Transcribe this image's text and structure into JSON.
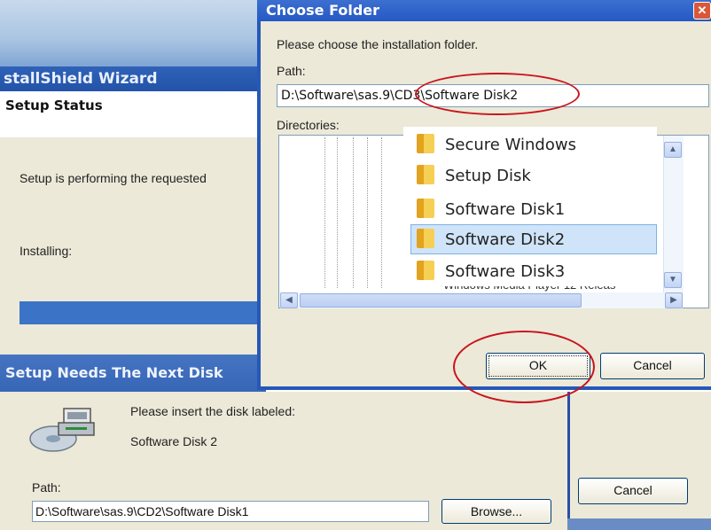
{
  "wizard": {
    "title_partial": "stallShield Wizard",
    "section": "Setup Status",
    "performing_text": "Setup is performing the requested",
    "installing_label": "Installing:",
    "progress_fraction": 1.0
  },
  "next_disk": {
    "title": "Setup Needs The Next Disk",
    "insert_text": "Please insert the disk labeled:",
    "disk_label": "Software Disk 2",
    "path_label": "Path:",
    "path_value": "D:\\Software\\sas.9\\CD2\\Software Disk1",
    "browse_label": "Browse...",
    "cancel_label": "Cancel"
  },
  "dialog": {
    "title": "Choose Folder",
    "close_glyph": "✕",
    "instruction": "Please choose the installation folder.",
    "path_label": "Path:",
    "path_value": "D:\\Software\\sas.9\\CD3\\Software Disk2",
    "directories_label": "Directories:",
    "folders": [
      {
        "name": "Secure Windows",
        "selected": false
      },
      {
        "name": "Setup Disk",
        "selected": false
      },
      {
        "name": "Software Disk1",
        "selected": false
      },
      {
        "name": "Software Disk2",
        "selected": true
      },
      {
        "name": "Software Disk3",
        "selected": false
      }
    ],
    "partial_item_text": "Windows Media Player 12 Releas",
    "ok_label": "OK",
    "cancel_label": "Cancel"
  },
  "scroll": {
    "up_glyph": "▲",
    "down_glyph": "▼",
    "left_glyph": "◀",
    "right_glyph": "▶"
  },
  "colors": {
    "annotation_red": "#c8141e",
    "title_blue": "#2559c4"
  }
}
